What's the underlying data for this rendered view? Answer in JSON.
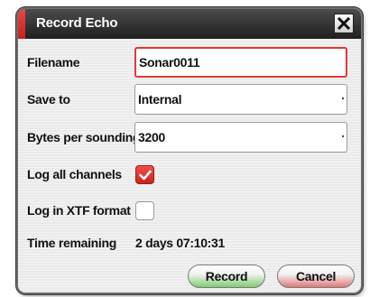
{
  "dialog": {
    "title": "Record Echo",
    "close_icon": "close-icon"
  },
  "form": {
    "filename": {
      "label": "Filename",
      "value": "Sonar0011"
    },
    "save_to": {
      "label": "Save to",
      "value": "Internal"
    },
    "bytes_per_sounding": {
      "label": "Bytes per sounding",
      "value": "3200"
    },
    "log_all_channels": {
      "label": "Log all channels",
      "checked": true
    },
    "log_xtf": {
      "label": "Log in XTF format",
      "checked": false
    },
    "time_remaining": {
      "label": "Time remaining",
      "value": "2 days 07:10:31"
    }
  },
  "buttons": {
    "record_label": "Record",
    "cancel_label": "Cancel"
  },
  "colors": {
    "accent": "#e23a35",
    "title_bg": "#2a2a2a",
    "record_button": "#7fcc72",
    "cancel_button": "#e07a7a"
  }
}
